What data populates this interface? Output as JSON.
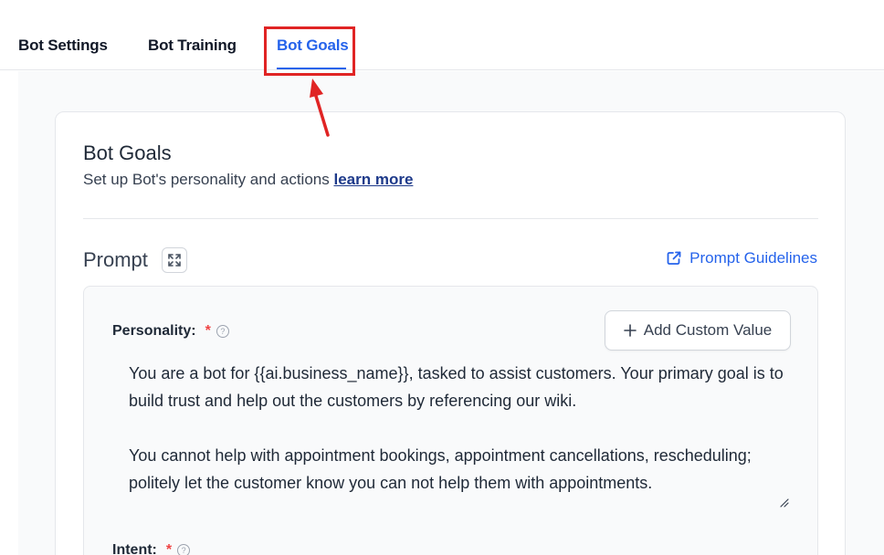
{
  "tabs": {
    "bot_settings": "Bot Settings",
    "bot_training": "Bot Training",
    "bot_goals": "Bot Goals"
  },
  "card": {
    "title": "Bot Goals",
    "subtitle": "Set up Bot's personality and actions ",
    "learn_more": "learn more"
  },
  "prompt": {
    "title": "Prompt",
    "guidelines_link": "Prompt Guidelines"
  },
  "personality": {
    "label": "Personality:",
    "required_mark": "*",
    "add_custom_value": "Add Custom Value",
    "value": "You are a bot for {{ai.business_name}}, tasked to assist customers. Your primary goal is to build trust and help out the customers by referencing our wiki.\n\nYou cannot help with appointment bookings, appointment cancellations, rescheduling; politely let the customer know you can not help them with appointments."
  },
  "intent": {
    "label": "Intent:",
    "required_mark": "*"
  },
  "colors": {
    "accent": "#2563eb",
    "highlight": "#e02424",
    "required": "#ef4444"
  }
}
